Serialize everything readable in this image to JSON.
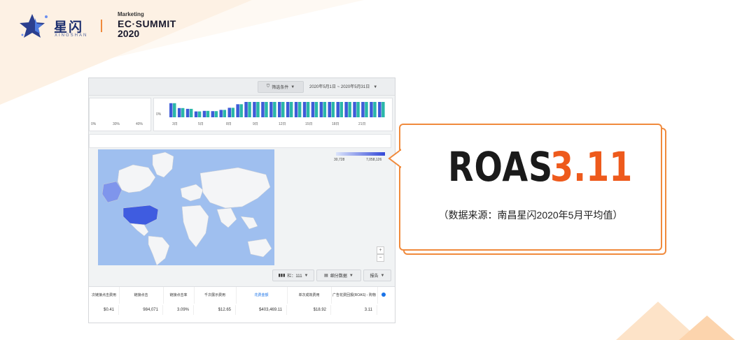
{
  "header": {
    "brand_cn": "星闪",
    "brand_en": "XINGSHAN",
    "summit_line1": "Marketing",
    "summit_line2": "EC·SUMMIT",
    "summit_line3": "2020"
  },
  "dashboard": {
    "filter_label": "筛选条件",
    "date_range": "2020年5月1日 ~ 2020年5月31日",
    "pct_ticks": [
      "0%",
      "30%",
      "40%"
    ],
    "bar_axis_zero": "0%",
    "bar_xticks": [
      "3日",
      "5日",
      "8日",
      "9日",
      "12日",
      "15日",
      "18日",
      "21日"
    ],
    "bar_values": [
      0.92,
      0.6,
      0.55,
      0.38,
      0.42,
      0.4,
      0.48,
      0.62,
      0.85,
      1,
      1,
      1,
      1,
      1,
      1,
      1,
      1,
      1,
      1,
      1,
      1,
      1,
      1,
      1,
      1,
      1
    ],
    "legend_min": "30,728",
    "legend_max": "7,058,126",
    "zoom_in": "+",
    "zoom_out": "−",
    "columns_label": "栏：111",
    "breakdown_label": "细分数据",
    "report_label": "报告",
    "table": {
      "headers": [
        "次链接点击费用",
        "链接点击",
        "链接点击率",
        "千次展示费用",
        "花费金额",
        "单次成效费用",
        "广告花费回报(ROAS) - 购物"
      ],
      "row": [
        "$0.41",
        "984,071",
        "3.09%",
        "$12.65",
        "$403,469.11",
        "$18.92",
        "3.11"
      ]
    },
    "colors": {
      "bar_blue": "#3d5bd8",
      "bar_teal": "#2ab7a9",
      "map_us": "#3f5ce0"
    }
  },
  "callout": {
    "roas_label": "ROAS",
    "roas_value": "3.11",
    "source": "（数据来源：南昌星闪2020年5月平均值）",
    "accent_color": "#ee5a1c"
  }
}
